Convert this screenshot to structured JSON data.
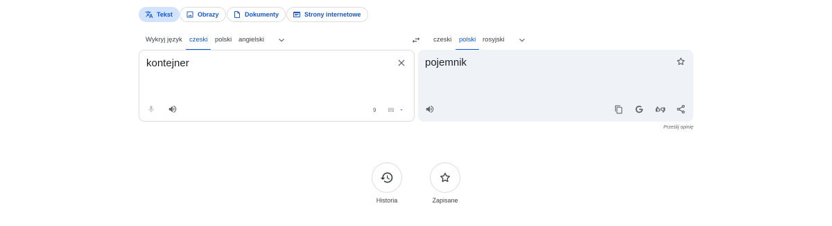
{
  "modes": [
    {
      "label": "Tekst",
      "icon": "translate-icon",
      "active": true
    },
    {
      "label": "Obrazy",
      "icon": "image-icon",
      "active": false
    },
    {
      "label": "Dokumenty",
      "icon": "document-icon",
      "active": false
    },
    {
      "label": "Strony internetowe",
      "icon": "website-icon",
      "active": false
    }
  ],
  "source_langs": [
    "Wykryj język",
    "czeski",
    "polski",
    "angielski"
  ],
  "source_selected": "czeski",
  "target_langs": [
    "czeski",
    "polski",
    "rosyjski"
  ],
  "target_selected": "polski",
  "source": {
    "text": "kontejner",
    "char_count": "9"
  },
  "target": {
    "text": "pojemnik"
  },
  "feedback_label": "Prześlij opinię",
  "history_label": "Historia",
  "saved_label": "Zapisane",
  "colors": {
    "accent": "#0b57d0",
    "chip_active_bg": "#d3e3fd",
    "target_panel_bg": "#eff3f8"
  }
}
